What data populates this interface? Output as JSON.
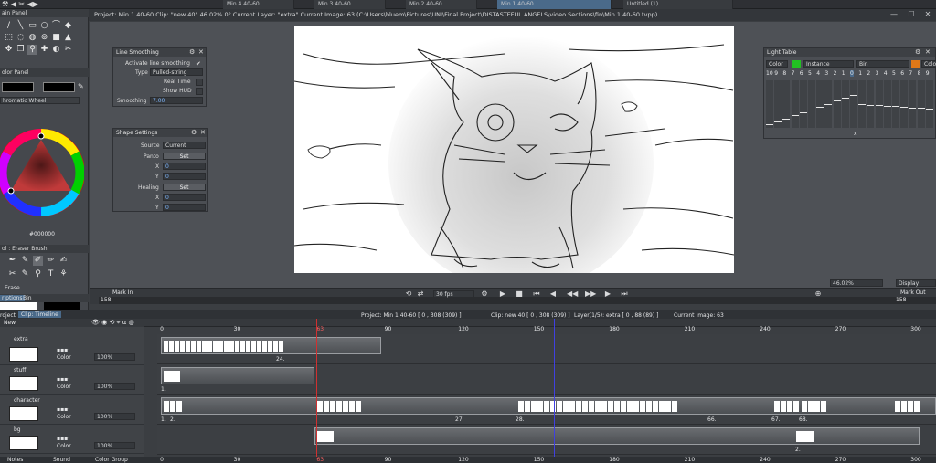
{
  "top_tabs": [
    "Min 4 40-60",
    "Min 3 40-60",
    "Min 2 40-60",
    "Min 1 40-60",
    "Untitled (1)"
  ],
  "title_bar": "Project: Min 1 40-60  Clip: \"new 40\"  46.02%  0°  Current Layer: \"extra\"  Current Image: 63  (C:\\Users\\bluem\\Pictures\\UNI\\Final Project\\DISTASTEFUL ANGELS\\video Sections\\fin\\Min 1 40-60.tvpp)",
  "left_panel": {
    "main_panel": "ain Panel",
    "color_panel": "olor Panel",
    "wheel_mode": "hromatic Wheel",
    "hex": "#000000",
    "tool_label": "ol : Eraser Brush",
    "erase_label": "Erase",
    "tabs": [
      "riptions",
      "Bin"
    ]
  },
  "line_smoothing": {
    "title": "Line Smoothing",
    "activate": "Activate line smoothing",
    "type_label": "Type",
    "type_value": "Pulled-string",
    "real_time": "Real Time",
    "show_hud": "Show HUD",
    "smoothing_label": "Smoothing",
    "smoothing_value": "7.00"
  },
  "shape_settings": {
    "title": "Shape Settings",
    "source_label": "Source",
    "source_value": "Current",
    "panto_label": "Panto",
    "set1": "Set",
    "x1": "0",
    "y1": "0",
    "healing_label": "Healing",
    "set2": "Set",
    "x2": "0",
    "y2": "0"
  },
  "light_table": {
    "title": "Light Table",
    "color": "Color",
    "instance": "Instance",
    "bin": "Bin",
    "color2": "Colo",
    "left_numbers": [
      "10",
      "9",
      "8",
      "7",
      "6",
      "5",
      "4",
      "3",
      "2",
      "1",
      "0"
    ],
    "right_numbers": [
      "1",
      "2",
      "3",
      "4",
      "5",
      "6",
      "7",
      "8",
      "9"
    ],
    "x_label": "x",
    "accent_green": "#22c022",
    "accent_orange": "#e07818"
  },
  "transport": {
    "mark_in": "Mark In",
    "mark_in_value": "158",
    "fps": "30 fps",
    "zoom": "46.02%",
    "display": "Display",
    "mark_out": "Mark Out",
    "mark_out_value": "158"
  },
  "timeline": {
    "tabs": [
      "roject",
      "Clip: Timeline"
    ],
    "info_project": "Project: Min 1 40-60 [ 0 , 308 (309) ]",
    "info_clip": "Clip: new 40 [ 0 , 308 (309) ]",
    "info_layer": "Layer(1/5): extra [ 0 , 88 (89) ]",
    "info_image": "Current Image: 63",
    "new_label": "New",
    "ruler": [
      "0",
      "30",
      "63",
      "90",
      "120",
      "150",
      "180",
      "210",
      "240",
      "270",
      "300"
    ],
    "bottom_ruler": [
      "0",
      "30",
      "63",
      "90",
      "120",
      "150",
      "180",
      "210",
      "240",
      "270",
      "300"
    ],
    "tracks": [
      {
        "name": "extra",
        "color": "Color",
        "opacity": "100%",
        "labels": [
          "24."
        ]
      },
      {
        "name": "stuff",
        "color": "Color",
        "opacity": "100%",
        "labels": [
          "1."
        ]
      },
      {
        "name": "character",
        "color": "Color",
        "opacity": "100%",
        "labels": [
          "1.",
          "2.",
          "27",
          "28.",
          "66.",
          "67.",
          "68."
        ]
      },
      {
        "name": "bg",
        "color": "Color",
        "opacity": "100%",
        "labels": [
          "2."
        ]
      }
    ]
  },
  "bottom_tabs": [
    "Notes",
    "Sound",
    "Color Group"
  ]
}
